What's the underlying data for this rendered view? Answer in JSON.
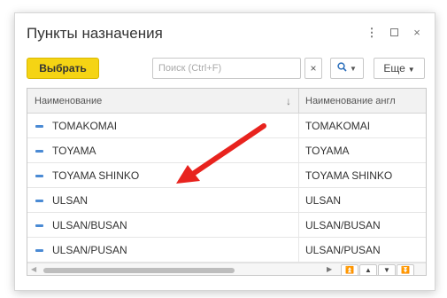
{
  "window": {
    "title": "Пункты назначения",
    "controls": {
      "more": "⋮",
      "maximize": "",
      "close": "×"
    }
  },
  "toolbar": {
    "select_label": "Выбрать",
    "search_placeholder": "Поиск (Ctrl+F)",
    "search_clear": "×",
    "search_icon": "🔍",
    "more_label": "Еще"
  },
  "grid": {
    "columns": [
      {
        "label": "Наименование",
        "sort_indicator": "↓"
      },
      {
        "label": "Наименование англ"
      }
    ],
    "rows": [
      {
        "name": "TOMAKOMAI",
        "name_en": "TOMAKOMAI"
      },
      {
        "name": "TOYAMA",
        "name_en": "TOYAMA"
      },
      {
        "name": "TOYAMA SHINKO",
        "name_en": "TOYAMA SHINKO"
      },
      {
        "name": "ULSAN",
        "name_en": "ULSAN"
      },
      {
        "name": "ULSAN/BUSAN",
        "name_en": "ULSAN/BUSAN"
      },
      {
        "name": "ULSAN/PUSAN",
        "name_en": "ULSAN/PUSAN"
      }
    ]
  },
  "colors": {
    "accent_button": "#f5d414",
    "row_marker": "#4a8ad4",
    "annotation_arrow": "#e8231e"
  },
  "icons": {
    "search": "magnifier-icon",
    "row": "dash-icon",
    "nav": [
      "first-icon",
      "up-icon",
      "down-icon",
      "last-icon"
    ]
  }
}
